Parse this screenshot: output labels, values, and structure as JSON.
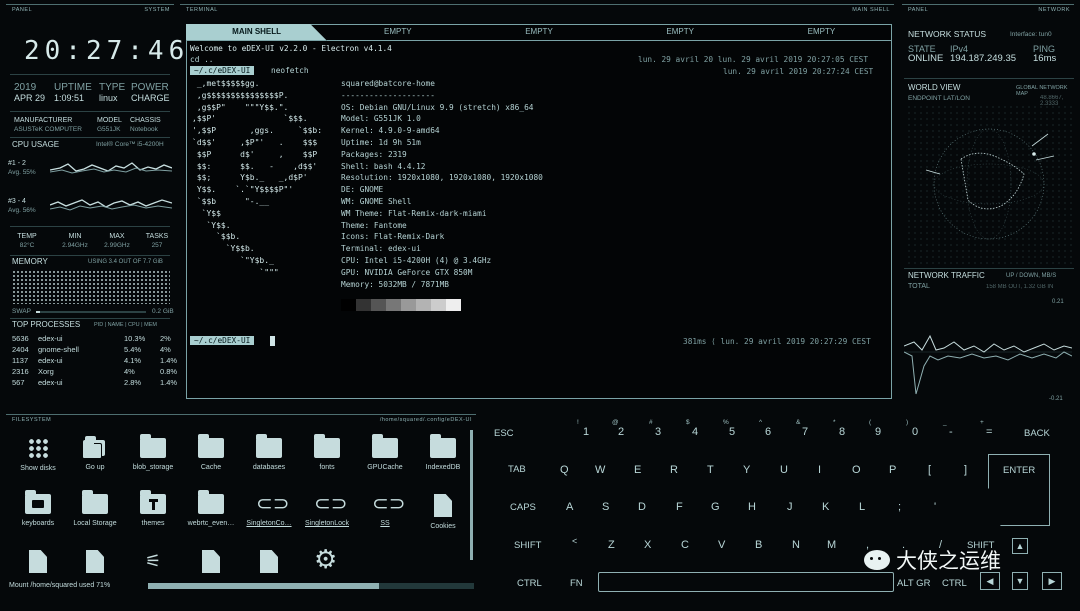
{
  "panel": {
    "left_title": "PANEL",
    "right_title": "SYSTEM",
    "clock": "20:27:46",
    "date": {
      "year": "2019",
      "day": "APR 29"
    },
    "uptime": {
      "label": "UPTIME",
      "value": "1:09:51"
    },
    "type": {
      "label": "TYPE",
      "value": "linux"
    },
    "power": {
      "label": "POWER",
      "value": "CHARGE"
    },
    "manufacturer": {
      "label": "MANUFACTURER",
      "value": "ASUSTeK COMPUTER"
    },
    "model": {
      "label": "MODEL",
      "value": "G551JK"
    },
    "chassis": {
      "label": "CHASSIS",
      "value": "Notebook"
    },
    "cpu": {
      "label": "CPU USAGE",
      "name": "Intel® Core™ i5-4200H",
      "core1": {
        "label": "#1 - 2",
        "avg": "Avg. 55%"
      },
      "core2": {
        "label": "#3 - 4",
        "avg": "Avg. 56%"
      }
    },
    "stats": {
      "temp_l": "TEMP",
      "temp": "82°C",
      "min_l": "MIN",
      "min": "2.94GHz",
      "max_l": "MAX",
      "max": "2.99GHz",
      "tasks_l": "TASKS",
      "tasks": "257"
    },
    "memory": {
      "label": "MEMORY",
      "usage": "USING 3.4 OUT OF 7.7 GiB",
      "swap": "SWAP",
      "swap_val": "0.2 GiB"
    },
    "processes": {
      "label": "TOP PROCESSES",
      "cols": "PID | NAME | CPU | MEM",
      "rows": [
        {
          "pid": "5636",
          "name": "edex-ui",
          "cpu": "10.3%",
          "mem": "2%"
        },
        {
          "pid": "2404",
          "name": "gnome-shell",
          "cpu": "5.4%",
          "mem": "4%"
        },
        {
          "pid": "1137",
          "name": "edex-ui",
          "cpu": "4.1%",
          "mem": "1.4%"
        },
        {
          "pid": "2316",
          "name": "Xorg",
          "cpu": "4%",
          "mem": "0.8%"
        },
        {
          "pid": "567",
          "name": "edex-ui",
          "cpu": "2.8%",
          "mem": "1.4%"
        }
      ]
    }
  },
  "terminal": {
    "title": "TERMINAL",
    "right": "MAIN SHELL",
    "tabs": [
      "MAIN SHELL",
      "EMPTY",
      "EMPTY",
      "EMPTY",
      "EMPTY"
    ],
    "welcome": "Welcome to eDEX-UI v2.2.0 - Electron v4.1.4",
    "cd": "cd ..",
    "prompt1": "~/.c/eDEX-UI",
    "cmd1": "neofetch",
    "ts1": "lun. 29 avril 20 lun. 29 avril 2019 20:27:05 CEST",
    "ts2": "lun. 29 avril 2019 20:27:24 CEST",
    "ascii": " _,met$$$$$gg.\n ,g$$$$$$$$$$$$$$$P.\n ,g$$P\"    \"\"\"Y$$.\".\n,$$P'              `$$$.\n',$$P       ,ggs.     `$$b:\n`d$$'     ,$P\"'   .    $$$\n $$P      d$'     ,    $$P\n $$:      $$.   -    ,d$$'\n $$;      Y$b._   _,d$P'\n Y$$.    `.`\"Y$$$$P\"'\n `$$b      \"-.__\n  `Y$$\n   `Y$$.\n     `$$b.\n       `Y$$b.\n          `\"Y$b._\n              `\"\"\"",
    "info": "squared@batcore-home\n--------------------\nOS: Debian GNU/Linux 9.9 (stretch) x86_64\nModel: G551JK 1.0\nKernel: 4.9.0-9-amd64\nUptime: 1d 9h 51m\nPackages: 2319\nShell: bash 4.4.12\nResolution: 1920x1080, 1920x1080, 1920x1080\nDE: GNOME\nWM: GNOME Shell\nWM Theme: Flat-Remix-dark-miami\nTheme: Fantome\nIcons: Flat-Remix-Dark\nTerminal: edex-ui\nCPU: Intel i5-4200H (4) @ 3.4GHz\nGPU: NVIDIA GeForce GTX 850M\nMemory: 5032MB / 7871MB",
    "prompt2": "~/.c/eDEX-UI",
    "status": "381ms ⟨ lun. 29 avril 2019 20:27:29 CEST"
  },
  "network": {
    "left_title": "PANEL",
    "right_title": "NETWORK",
    "status": {
      "label": "NETWORK STATUS",
      "iface": "Interface: tun0",
      "state_l": "STATE",
      "state": "ONLINE",
      "ip_l": "IPv4",
      "ip": "194.187.249.35",
      "ping_l": "PING",
      "ping": "16ms"
    },
    "world": {
      "label": "WORLD VIEW",
      "right": "GLOBAL NETWORK MAP",
      "sub": "ENDPOINT LAT/LON",
      "coords": "48.8667, 2.3333"
    },
    "traffic": {
      "label": "NETWORK TRAFFIC",
      "right": "UP / DOWN, MB/S",
      "total": "TOTAL",
      "total_val": "158 MB OUT, 1.32 GB IN",
      "top": "0.21",
      "bottom": "-0.21"
    }
  },
  "filesystem": {
    "title": "FILESYSTEM",
    "path": "/home/squared/.config/eDEX-UI",
    "items": [
      "Show disks",
      "Go up",
      "blob_storage",
      "Cache",
      "databases",
      "fonts",
      "GPUCache",
      "IndexedDB",
      "keyboards",
      "Local Storage",
      "themes",
      "webrtc_even…",
      "SingletonCo…",
      "SingletonLock",
      "SS",
      "Cookies"
    ],
    "mount": "Mount /home/squared used 71%",
    "usage": 0.71
  },
  "keyboard": {
    "row1": [
      [
        "ESC",
        ""
      ],
      [
        "1",
        "!"
      ],
      [
        "2",
        "@"
      ],
      [
        "3",
        "#"
      ],
      [
        "4",
        "$"
      ],
      [
        "5",
        "%"
      ],
      [
        "6",
        "^"
      ],
      [
        "7",
        "&"
      ],
      [
        "8",
        "*"
      ],
      [
        "9",
        "("
      ],
      [
        "0",
        ")"
      ],
      [
        "-",
        "_"
      ],
      [
        "=",
        "+"
      ],
      [
        "BACK",
        ""
      ]
    ],
    "row2": [
      "TAB",
      "Q",
      "W",
      "E",
      "R",
      "T",
      "Y",
      "U",
      "I",
      "O",
      "P",
      "[",
      "]",
      "ENTER"
    ],
    "row3": [
      "CAPS",
      "A",
      "S",
      "D",
      "F",
      "G",
      "H",
      "J",
      "K",
      "L",
      ";",
      "'"
    ],
    "row4": [
      "SHIFT",
      "<",
      "Z",
      "X",
      "C",
      "V",
      "B",
      "N",
      "M",
      ",",
      ".",
      "/",
      "SHIFT"
    ],
    "row5": [
      "CTRL",
      "FN",
      "ALT GR",
      "CTRL"
    ]
  },
  "watermark": "大侠之运维"
}
